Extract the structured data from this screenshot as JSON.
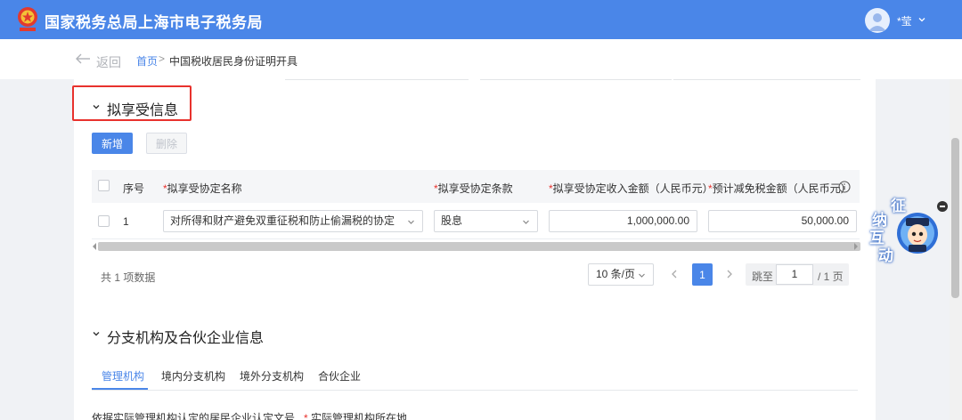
{
  "header": {
    "title": "国家税务总局上海市电子税务局",
    "user": "*莹"
  },
  "subnav": {
    "back": "返回",
    "crumbs": {
      "home": "首页",
      "sep": ">",
      "current": "中国税收居民身份证明开具"
    }
  },
  "section_benefit": {
    "title": "拟享受信息",
    "buttons": {
      "add": "新增",
      "delete": "删除"
    },
    "columns": {
      "index": "序号",
      "agreement": "拟享受协定名称",
      "clause": "拟享受协定条款",
      "income": "拟享受协定收入金额（人民币元）",
      "tax": "预计减免税金额（人民币元）"
    },
    "required_mark": "*",
    "rows": [
      {
        "index": "1",
        "agreement": "对所得和财产避免双重征税和防止偷漏税的协定",
        "clause": "股息",
        "income": "1,000,000.00",
        "tax": "50,000.00"
      }
    ],
    "pagination": {
      "total": "共 1 项数据",
      "page_size": "10 条/页",
      "current_page": "1",
      "jump_label": "跳至",
      "jump_value": "1",
      "total_pages": "/ 1 页"
    }
  },
  "section_branch": {
    "title": "分支机构及合伙企业信息",
    "tabs": [
      "管理机构",
      "境内分支机构",
      "境外分支机构",
      "合伙企业"
    ],
    "fields": {
      "doc": "依据实际管理机构认定的居民企业认定文号",
      "location": "实际管理机构所在地",
      "required_mark": "*"
    }
  },
  "float_widget": {
    "chars": [
      "征",
      "纳",
      "互",
      "动"
    ]
  },
  "colors": {
    "primary": "#4a86e8",
    "required": "#e8322d",
    "highlight": "#e8322d"
  }
}
